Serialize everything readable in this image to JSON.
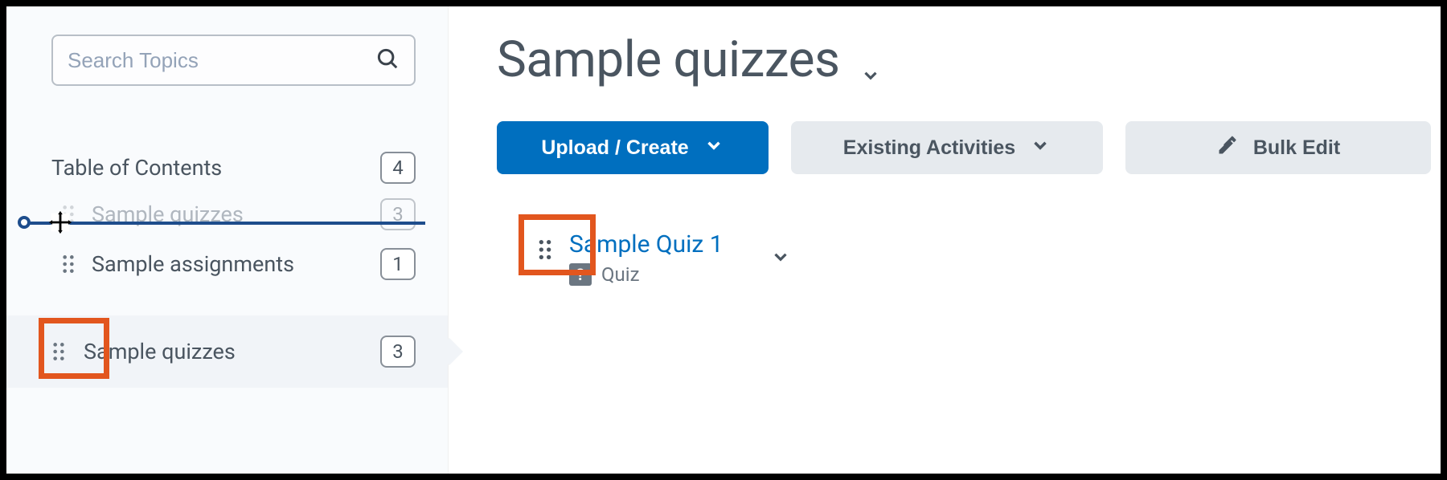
{
  "search": {
    "placeholder": "Search Topics"
  },
  "toc": {
    "header": "Table of Contents",
    "header_count": "4",
    "items": [
      {
        "label": "Sample quizzes",
        "count": "3"
      },
      {
        "label": "Sample assignments",
        "count": "1"
      }
    ],
    "active": {
      "label": "Sample quizzes",
      "count": "3"
    }
  },
  "main": {
    "title": "Sample quizzes",
    "buttons": {
      "upload": "Upload / Create",
      "existing": "Existing Activities",
      "bulk": "Bulk Edit"
    },
    "items": [
      {
        "title": "Sample Quiz 1",
        "type": "Quiz"
      }
    ]
  },
  "icons": {
    "question": "?"
  }
}
